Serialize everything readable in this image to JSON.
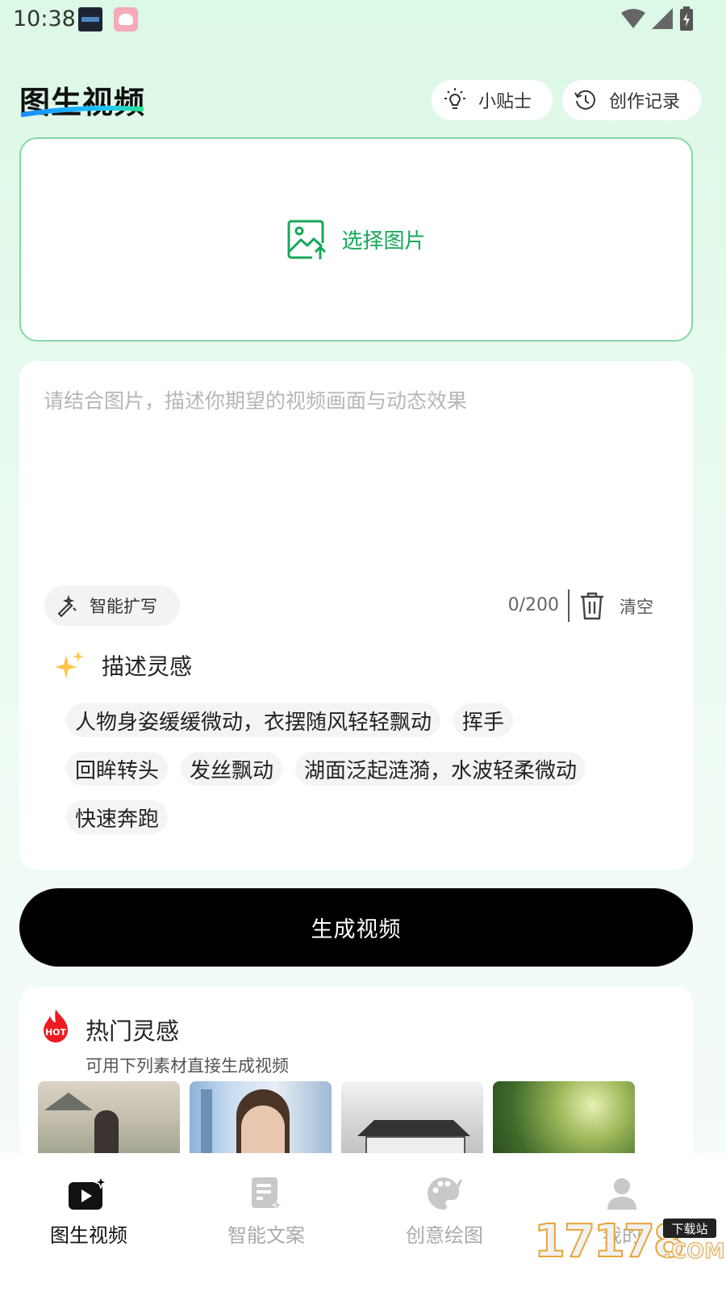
{
  "status_bar": {
    "time": "10:38"
  },
  "header": {
    "title": "图生视频",
    "tips_label": "小贴士",
    "history_label": "创作记录"
  },
  "upload": {
    "label": "选择图片"
  },
  "prompt": {
    "placeholder": "请结合图片，描述你期望的视频画面与动态效果",
    "value": "",
    "expand_label": "智能扩写",
    "char_count": "0/200",
    "clear_label": "清空"
  },
  "inspiration": {
    "title": "描述灵感",
    "chips": [
      "人物身姿缓缓微动，衣摆随风轻轻飘动",
      "挥手",
      "回眸转头",
      "发丝飘动",
      "湖面泛起涟漪，水波轻柔微动",
      "快速奔跑"
    ]
  },
  "generate_label": "生成视频",
  "hot": {
    "badge": "HOT",
    "title": "热门灵感",
    "subtitle": "可用下列素材直接生成视频"
  },
  "nav": {
    "items": [
      "图生视频",
      "智能文案",
      "创意绘图",
      "我的"
    ],
    "active": "图生视频"
  },
  "watermark": {
    "text": "17178",
    "badge": "下载站",
    "suffix": ".COM"
  },
  "colors": {
    "accent": "#16a85a",
    "border": "#86d7a7",
    "primary_button": "#000000"
  }
}
